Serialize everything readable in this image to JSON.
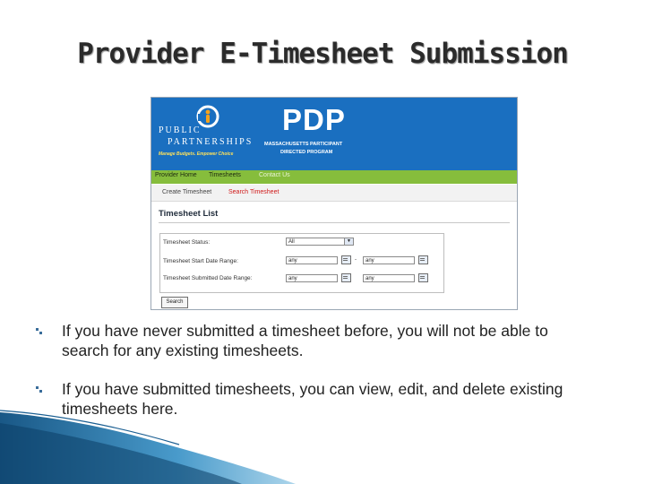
{
  "slide": {
    "title": "Provider E-Timesheet Submission",
    "bullets": [
      "If you have never submitted a timesheet before, you will not be able to search for any existing timesheets.",
      "If you have submitted timesheets, you can view, edit, and delete existing timesheets here."
    ]
  },
  "screenshot": {
    "logo": {
      "line1": "PUBLIC",
      "line2": "PARTNERSHIPS",
      "tagline": "Manage Budgets. Empower Choice"
    },
    "header": {
      "title": "PDP",
      "subtitle_line1": "MASSACHUSETTS PARTICIPANT",
      "subtitle_line2": "DIRECTED PROGRAM"
    },
    "nav": [
      "Provider Home",
      "Timesheets",
      "Contact Us"
    ],
    "subnav": [
      "Create Timesheet",
      "Search Timesheet"
    ],
    "list_title": "Timesheet List",
    "filters": {
      "status_label": "Timesheet Status:",
      "status_value": "All",
      "start_label": "Timesheet Start Date Range:",
      "start_from": "any",
      "start_to": "any",
      "submitted_label": "Timesheet Submitted Date Range:",
      "submitted_from": "any",
      "submitted_to": "any",
      "range_dash": "-"
    },
    "search_button": "Search"
  },
  "colors": {
    "header_blue": "#1a6fc0",
    "nav_green": "#86bd3c",
    "active_red": "#d01b1b",
    "bullet_blue": "#3a6d9a"
  }
}
